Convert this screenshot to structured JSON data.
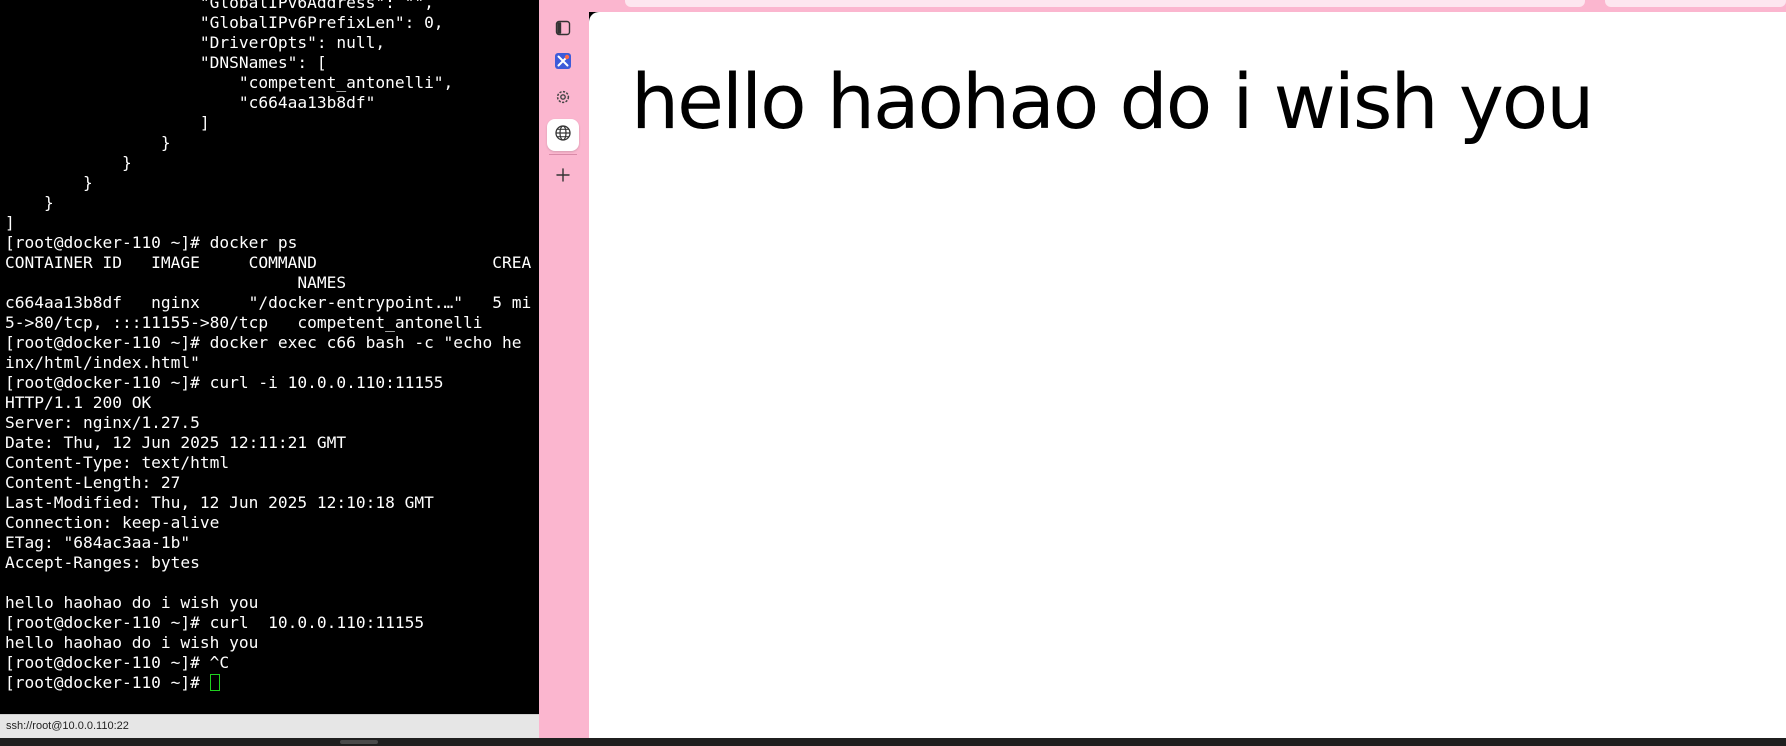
{
  "terminal": {
    "lines": [
      "                    \"GlobalIPv6Address\": \"\",",
      "                    \"GlobalIPv6PrefixLen\": 0,",
      "                    \"DriverOpts\": null,",
      "                    \"DNSNames\": [",
      "                        \"competent_antonelli\",",
      "                        \"c664aa13b8df\"",
      "                    ]",
      "                }",
      "            }",
      "        }",
      "    }",
      "]",
      "[root@docker-110 ~]# docker ps",
      "CONTAINER ID   IMAGE     COMMAND                  CREA",
      "                              NAMES",
      "c664aa13b8df   nginx     \"/docker-entrypoint.…\"   5 mi",
      "5->80/tcp, :::11155->80/tcp   competent_antonelli",
      "[root@docker-110 ~]# docker exec c66 bash -c \"echo he",
      "inx/html/index.html\"",
      "[root@docker-110 ~]# curl -i 10.0.0.110:11155",
      "HTTP/1.1 200 OK",
      "Server: nginx/1.27.5",
      "Date: Thu, 12 Jun 2025 12:11:21 GMT",
      "Content-Type: text/html",
      "Content-Length: 27",
      "Last-Modified: Thu, 12 Jun 2025 12:10:18 GMT",
      "Connection: keep-alive",
      "ETag: \"684ac3aa-1b\"",
      "Accept-Ranges: bytes",
      "",
      "hello haohao do i wish you",
      "[root@docker-110 ~]# curl  10.0.0.110:11155",
      "hello haohao do i wish you",
      "[root@docker-110 ~]# ^C"
    ],
    "prompt": "[root@docker-110 ~]# ",
    "status": "ssh://root@10.0.0.110:22",
    "cursor_color": "#1fd01f"
  },
  "browser": {
    "sidebar": {
      "background": "#fbb6cf",
      "icons": [
        "tabs-panel-icon",
        "extension-icon",
        "settings-gear-icon",
        "globe-icon",
        "add-icon"
      ]
    },
    "page": {
      "heading": "hello haohao do i wish you"
    }
  }
}
